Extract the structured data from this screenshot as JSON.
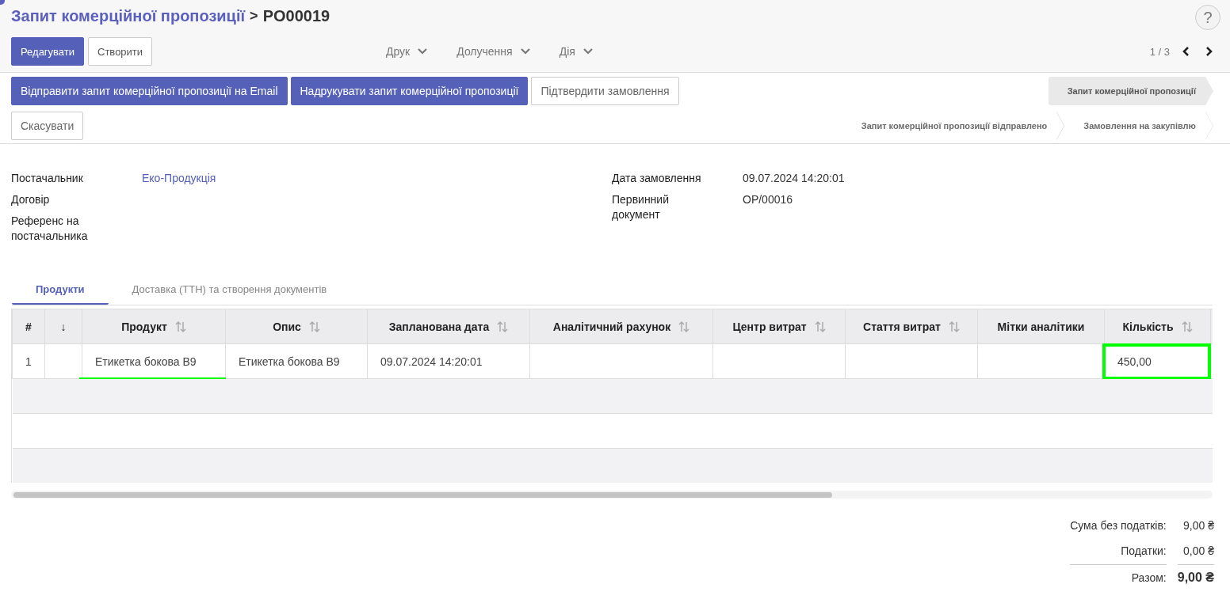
{
  "breadcrumb": {
    "parent": "Запит комерційної пропозиції",
    "separator": ">",
    "current": "PO00019"
  },
  "help_label": "?",
  "main_buttons": [
    {
      "label": "Редагувати",
      "kind": "primary"
    },
    {
      "label": "Створити",
      "kind": "secondary"
    }
  ],
  "dropdowns": [
    "Друк",
    "Долучення",
    "Дія"
  ],
  "pager": "1 / 3",
  "action_buttons": [
    {
      "label": "Відправити запит комерційної пропозиції на Email",
      "kind": "primary"
    },
    {
      "label": "Надрукувати запит комерційної пропозиції",
      "kind": "primary"
    },
    {
      "label": "Підтвердити замовлення",
      "kind": "secondary"
    },
    {
      "label": "Скасувати",
      "kind": "secondary"
    }
  ],
  "stages": [
    {
      "label": "Запит комерційної пропозиції",
      "selected": true
    },
    {
      "label": "Запит комерційної пропозиції відправлено",
      "selected": false
    },
    {
      "label": "Замовлення на закупівлю",
      "selected": false
    }
  ],
  "fields_left": [
    {
      "label": "Постачальник",
      "value": "Еко-Продукція",
      "kind": "link"
    },
    {
      "label": "Договір",
      "kind": "empty"
    },
    {
      "label": "Референс на постачальника",
      "kind": "empty"
    }
  ],
  "fields_right": [
    {
      "label": "Дата замовлення",
      "value": "09.07.2024 14:20:01",
      "kind": "text"
    },
    {
      "label": "Первинний документ",
      "value": "OP/00016",
      "kind": "text"
    }
  ],
  "tabs": [
    {
      "label": "Продукти",
      "selected": true
    },
    {
      "label": "Доставка (ТТН) та створення документів",
      "selected": false
    }
  ],
  "table": {
    "columns": [
      {
        "label": "#",
        "sortable": false
      },
      {
        "label": "↓",
        "sortable": false
      },
      {
        "label": "Продукт",
        "sortable": true
      },
      {
        "label": "Опис",
        "sortable": true
      },
      {
        "label": "Запланована дата",
        "sortable": true
      },
      {
        "label": "Аналітичний рахунок",
        "sortable": true
      },
      {
        "label": "Центр витрат",
        "sortable": true
      },
      {
        "label": "Стаття витрат",
        "sortable": true
      },
      {
        "label": "Мітки аналітики",
        "sortable": false
      },
      {
        "label": "Кількість",
        "sortable": true
      }
    ],
    "rows": [
      [
        {
          "text": "1",
          "underlined": false,
          "framed": false
        },
        {
          "text": "",
          "underlined": false,
          "framed": false
        },
        {
          "text": "Етикетка бокова B9",
          "underlined": true,
          "framed": false
        },
        {
          "text": "Етикетка бокова B9",
          "underlined": false,
          "framed": false
        },
        {
          "text": "09.07.2024 14:20:01",
          "underlined": false,
          "framed": false
        },
        {
          "text": "",
          "underlined": false,
          "framed": false
        },
        {
          "text": "",
          "underlined": false,
          "framed": false
        },
        {
          "text": "",
          "underlined": false,
          "framed": false
        },
        {
          "text": "",
          "underlined": false,
          "framed": false
        },
        {
          "text": "450,00",
          "underlined": false,
          "framed": true
        }
      ]
    ]
  },
  "totals": [
    {
      "label": "Сума без податків:",
      "value": "9,00 ₴",
      "kind": "plain"
    },
    {
      "label": "Податки:",
      "value": "0,00 ₴",
      "kind": "plain"
    },
    {
      "label": "Разом:",
      "value": "9,00 ₴",
      "kind": "total"
    }
  ]
}
